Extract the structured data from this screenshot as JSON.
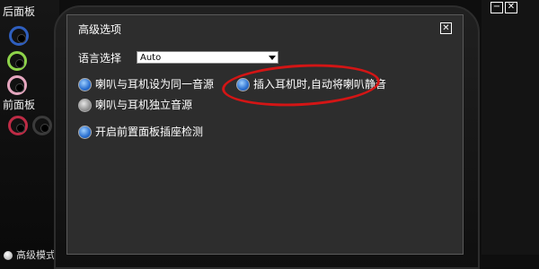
{
  "left_panel": {
    "rear_label": "后面板",
    "front_label": "前面板",
    "advanced_mode_label": "高级模式"
  },
  "window_controls": {
    "minimize": "−",
    "close": "✕"
  },
  "dialog": {
    "title": "高级选项",
    "close_label": "✕",
    "language_label": "语言选择",
    "language_value": "Auto",
    "options": [
      {
        "label": "喇叭与耳机设为同一音源",
        "checked": true
      },
      {
        "label": "喇叭与耳机独立音源",
        "checked": false
      },
      {
        "label": "开启前置面板插座检测",
        "checked": true
      },
      {
        "label": "插入耳机时,自动将喇叭静音",
        "checked": true
      }
    ]
  },
  "colors": {
    "highlight": "#d31515",
    "radio_on": "#2a6fd0",
    "dialog_bg": "#2d2d2d"
  }
}
